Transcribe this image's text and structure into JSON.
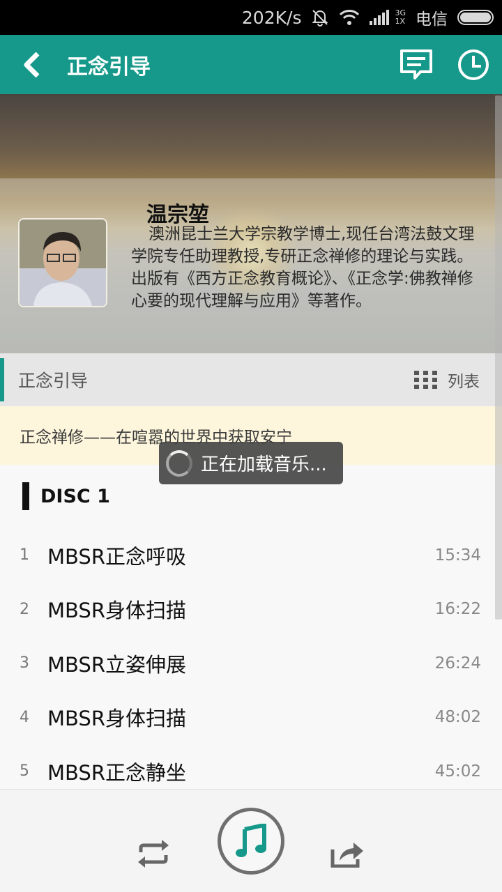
{
  "status_bar": {
    "speed": "202K/s",
    "network_top": "3G",
    "network_bottom": "1X",
    "carrier": "电信"
  },
  "app_bar": {
    "title": "正念引导"
  },
  "author": {
    "name": "温宗堃",
    "bio": "澳洲昆士兰大学宗教学博士,现任台湾法鼓文理学院专任助理教授,专研正念禅修的理论与实践。出版有《西方正念教育概论》、《正念学:佛教禅修心要的现代理解与应用》等著作。"
  },
  "section": {
    "title": "正念引导",
    "list_label": "列表"
  },
  "album": {
    "title": "正念禅修——在喧嚣的世界中获取安宁"
  },
  "toast": {
    "text": "正在加载音乐..."
  },
  "disc": {
    "label": "DISC 1"
  },
  "tracks": [
    {
      "num": "1",
      "title": "MBSR正念呼吸",
      "duration": "15:34"
    },
    {
      "num": "2",
      "title": "MBSR身体扫描",
      "duration": "16:22"
    },
    {
      "num": "3",
      "title": "MBSR立姿伸展",
      "duration": "26:24"
    },
    {
      "num": "4",
      "title": "MBSR身体扫描",
      "duration": "48:02"
    },
    {
      "num": "5",
      "title": "MBSR正念静坐",
      "duration": "45:02"
    }
  ],
  "colors": {
    "primary": "#16998a",
    "banner": "#fdf6dc"
  },
  "icons": {
    "back": "chevron-left-icon",
    "comment": "comment-icon",
    "history": "clock-icon",
    "list": "grid-list-icon",
    "repeat": "repeat-icon",
    "play": "music-note-icon",
    "share": "share-icon"
  }
}
